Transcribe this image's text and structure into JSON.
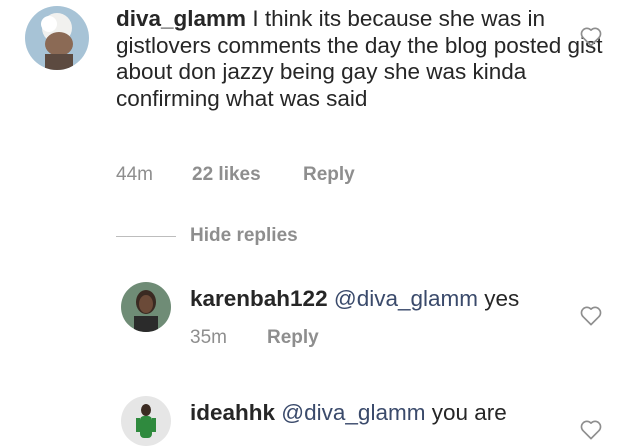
{
  "comments": [
    {
      "username": "diva_glamm",
      "text": " I think its because she was in gistlovers comments the day the blog posted gist about don jazzy being gay she was kinda confirming what was said",
      "time": "44m",
      "likes": "22 likes",
      "reply": "Reply"
    }
  ],
  "hide_replies": "Hide replies",
  "replies": [
    {
      "username": "karenbah122",
      "mention": "@diva_glamm",
      "text": " yes",
      "time": "35m",
      "reply": "Reply"
    },
    {
      "username": "ideahhk",
      "mention": "@diva_glamm",
      "text": " you are"
    }
  ],
  "icons": {
    "like": "heart-outline-icon"
  },
  "colors": {
    "text": "#262626",
    "meta": "#8e8e8e",
    "mention": "#3a4a6b"
  }
}
